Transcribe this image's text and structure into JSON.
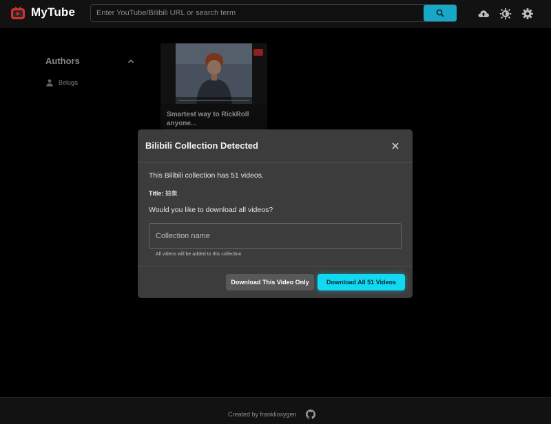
{
  "header": {
    "app_title": "MyTube",
    "search_placeholder": "Enter YouTube/Bilibili URL or search term",
    "icons": [
      "logo-icon",
      "search-icon",
      "cloud-upload-icon",
      "theme-icon",
      "gear-icon"
    ]
  },
  "sidebar": {
    "authors_title": "Authors",
    "authors": [
      {
        "name": "Beluga",
        "icon": "person-icon"
      }
    ]
  },
  "videos": [
    {
      "title": "Smartest way to RickRoll anyone...",
      "source": "youtube"
    }
  ],
  "modal": {
    "title": "Bilibili Collection Detected",
    "message": "This Bilibili collection has 51 videos.",
    "title_label": "Title:",
    "title_value": "抽象",
    "question": "Would you like to download all videos?",
    "collection_placeholder": "Collection name",
    "helper": "All videos will be added to this collection",
    "secondary_button": "Download This Video Only",
    "primary_button": "Download All 51 Videos"
  },
  "footer": {
    "text": "Created by franklioxygen",
    "icon": "github-icon"
  },
  "colors": {
    "accent": "#12d9f2",
    "search_button": "#17a8c7",
    "logo_red": "#d9302c",
    "modal_bg": "#3c3c3c",
    "page_bg": "#000000"
  }
}
